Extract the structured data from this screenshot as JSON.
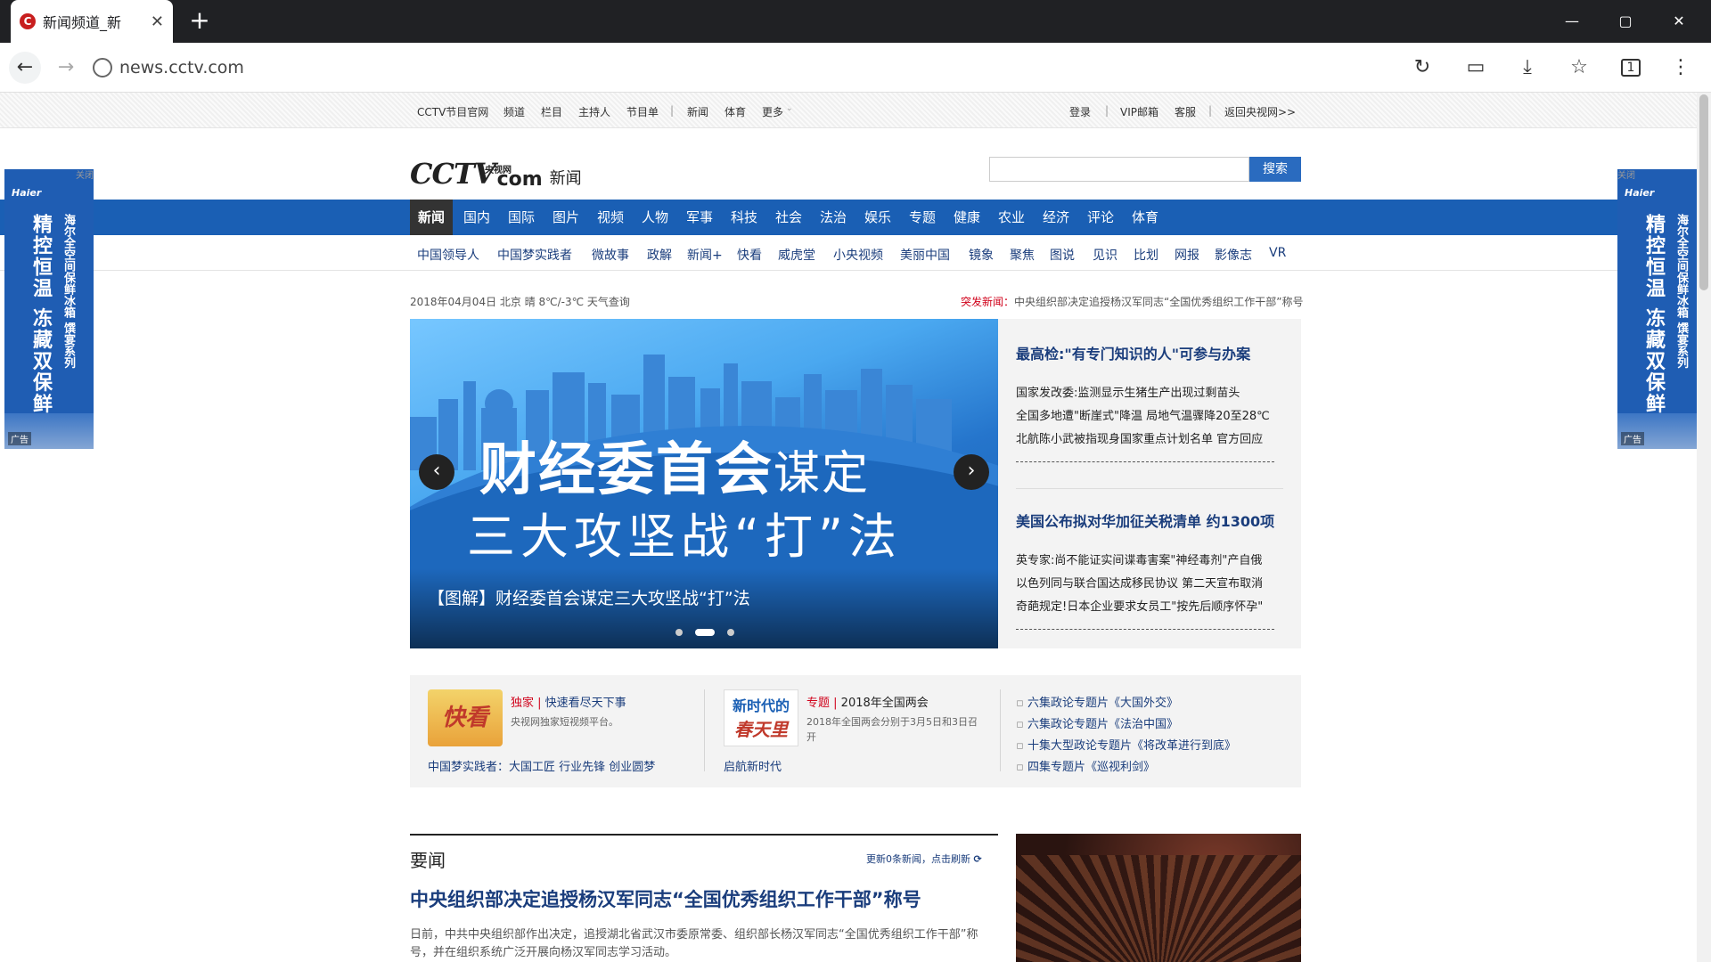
{
  "browser": {
    "tab_title": "新闻频道_新",
    "tab_close": "✕",
    "new_tab": "+",
    "url": "news.cctv.com",
    "window": {
      "minimize": "—",
      "maximize": "▢",
      "close": "✕"
    }
  },
  "topbar": {
    "left_links": [
      "CCTV节目官网",
      "频道",
      "栏目",
      "主持人",
      "节目单",
      "|",
      "新闻",
      "体育",
      "更多"
    ],
    "right_links": [
      "登录",
      "|",
      "VIP邮箱",
      "客服",
      "|",
      "返回央视网>>"
    ]
  },
  "logo": {
    "main": "CCTV",
    "com": "com",
    "sub": "央视网",
    "section": "新闻"
  },
  "search": {
    "placeholder": "",
    "button": "搜索"
  },
  "nav": [
    "新闻",
    "国内",
    "国际",
    "图片",
    "视频",
    "人物",
    "军事",
    "科技",
    "社会",
    "法治",
    "娱乐",
    "专题",
    "健康",
    "农业",
    "经济",
    "评论",
    "体育"
  ],
  "subnav": [
    "中国领导人",
    "中国梦实践者",
    "微故事",
    "政解",
    "新闻+",
    "快看",
    "威虎堂",
    "小央视频",
    "美丽中国",
    "镜象",
    "聚焦",
    "图说",
    "见识",
    "比划",
    "网报",
    "影像志",
    "VR"
  ],
  "side_ad": {
    "close": "关闭",
    "brand": "Haier",
    "line1": "精控恒温 冻藏双保鲜",
    "line2": "海尔全空间保鲜冰箱 馔宴系列",
    "ad": "广告"
  },
  "dateline": "2018年04月04日 北京 晴 8℃/-3℃ 天气查询",
  "breaking": {
    "label": "突发新闻：",
    "text": "中央组织部决定追授杨汉军同志“全国优秀组织工作干部”称号"
  },
  "slider": {
    "headline1": "财经委首会",
    "headline1_small": "谋定",
    "headline2": "三大攻坚战“打”法",
    "caption": "【图解】财经委首会谋定三大攻坚战“打”法",
    "prev": "‹",
    "next": "›",
    "active_slide": 2,
    "slide_count": 3
  },
  "right_panel": {
    "block1": {
      "headline": "最高检:\"有专门知识的人\"可参与办案",
      "items": [
        "国家发改委:监测显示生猪生产出现过剩苗头",
        "全国多地遭\"断崖式\"降温 局地气温骤降20至28℃",
        "北航陈小武被指现身国家重点计划名单 官方回应"
      ]
    },
    "block2": {
      "headline": "美国公布拟对华加征关税清单 约1300项",
      "items": [
        "英专家:尚不能证实间谍毒害案\"神经毒剂\"产自俄",
        "以色列同与联合国达成移民协议 第二天宣布取消",
        "奇葩规定!日本企业要求女员工\"按先后顺序怀孕\""
      ]
    }
  },
  "promo": {
    "col1": {
      "thumb_text": "快看",
      "tag": "独家",
      "title": "快速看尽天下事",
      "desc": "央视网独家短视频平台。",
      "link": "中国梦实践者：大国工匠 行业先锋 创业圆梦"
    },
    "col2": {
      "thumb_text1": "新时代的",
      "thumb_text2": "春天里",
      "tag": "专题",
      "title": "2018年全国两会",
      "desc": "2018年全国两会分别于3月5日和3日召开",
      "link": "启航新时代"
    },
    "col3": [
      "六集政论专题片《大国外交》",
      "六集政论专题片《法治中国》",
      "十集大型政论专题片《将改革进行到底》",
      "四集专题片《巡视利剑》"
    ]
  },
  "news": {
    "section_title": "要闻",
    "refresh": "更新0条新闻，点击刷新",
    "headline": "中央组织部决定追授杨汉军同志“全国优秀组织工作干部”称号",
    "summary": "日前，中共中央组织部作出决定，追授湖北省武汉市委原常委、组织部长杨汉军同志“全国优秀组织工作干部”称号，并在组织系统广泛开展向杨汉军同志学习活动。"
  },
  "colors": {
    "brand_blue": "#1a5fb4",
    "link_blue": "#1a3d7c",
    "alert_red": "#d0021b"
  }
}
